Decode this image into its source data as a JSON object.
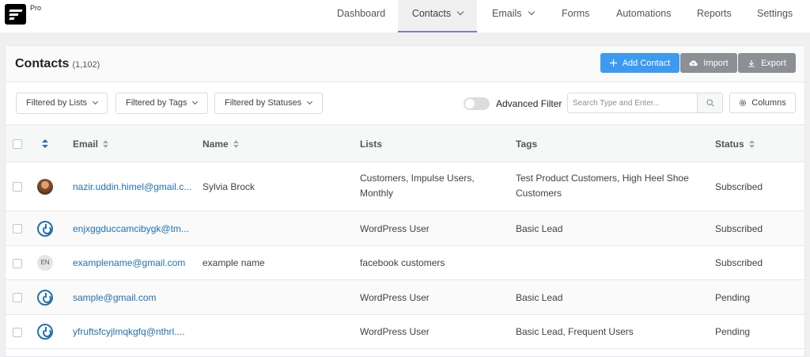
{
  "nav": {
    "badge": "Pro",
    "items": [
      {
        "label": "Dashboard"
      },
      {
        "label": "Contacts"
      },
      {
        "label": "Emails"
      },
      {
        "label": "Forms"
      },
      {
        "label": "Automations"
      },
      {
        "label": "Reports"
      },
      {
        "label": "Settings"
      }
    ]
  },
  "page": {
    "title": "Contacts",
    "count": "(1,102)",
    "add_contact_label": "Add Contact",
    "import_label": "Import",
    "export_label": "Export"
  },
  "filters": {
    "lists_label": "Filtered by Lists",
    "tags_label": "Filtered by Tags",
    "statuses_label": "Filtered by Statuses",
    "advanced_filter_label": "Advanced Filter",
    "advanced_filter_on": false,
    "search_placeholder": "Search Type and Enter...",
    "columns_label": "Columns"
  },
  "table": {
    "headers": {
      "email": "Email",
      "name": "Name",
      "lists": "Lists",
      "tags": "Tags",
      "status": "Status"
    },
    "rows": [
      {
        "avatar": "photo",
        "email": "nazir.uddin.himel@gmail.c...",
        "name": "Sylvia Brock",
        "lists": "Customers, Impulse Users, Monthly",
        "tags": "Test Product Customers, High Heel Shoe Customers",
        "status": "Subscribed"
      },
      {
        "avatar": "power-icon",
        "email": "enjxggduccamcibygk@tm...",
        "name": "",
        "lists": "WordPress User",
        "tags": "Basic Lead",
        "status": "Subscribed"
      },
      {
        "avatar": "initials",
        "initials": "EN",
        "email": "examplename@gmail.com",
        "name": "example name",
        "lists": "facebook customers",
        "tags": "",
        "status": "Subscribed"
      },
      {
        "avatar": "power-icon",
        "email": "sample@gmail.com",
        "name": "",
        "lists": "WordPress User",
        "tags": "Basic Lead",
        "status": "Pending"
      },
      {
        "avatar": "power-icon",
        "email": "yfruftsfcyjlmqkgfq@nthrl....",
        "name": "",
        "lists": "WordPress User",
        "tags": "Basic Lead, Frequent Users",
        "status": "Pending"
      }
    ]
  },
  "colors": {
    "accent": "#3c9bf1",
    "link": "#2271b1",
    "secondary_button": "#8c8f94",
    "active_tab_underline": "#7b7bd6"
  }
}
